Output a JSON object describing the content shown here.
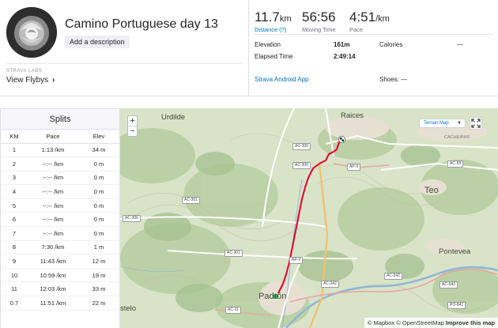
{
  "activity": {
    "title": "Camino Portuguese day 13",
    "add_description": "Add a description",
    "labs_caption": "STRAVA LABS",
    "flybys": "View Flybys"
  },
  "metrics": {
    "distance_value": "11.7",
    "distance_unit": "km",
    "distance_label": "Distance (?)",
    "moving_time_value": "56:56",
    "moving_time_label": "Moving Time",
    "pace_value": "4:51",
    "pace_unit": "/km",
    "pace_label": "Pace"
  },
  "stats": {
    "elevation_label": "Elevation",
    "elevation_value": "161m",
    "calories_label": "Calories",
    "calories_value": "—",
    "elapsed_label": "Elapsed Time",
    "elapsed_value": "2:49:14",
    "app_link": "Strava Android App",
    "shoes": "Shoes: —"
  },
  "splits": {
    "title": "Splits",
    "headers": [
      "KM",
      "Pace",
      "Elev"
    ],
    "rows": [
      {
        "km": "1",
        "pace": "1:13",
        "unit": "/km",
        "elev": "34 m"
      },
      {
        "km": "2",
        "pace": "--:--",
        "unit": "/km",
        "elev": "0 m"
      },
      {
        "km": "3",
        "pace": "--:--",
        "unit": "/km",
        "elev": "0 m"
      },
      {
        "km": "4",
        "pace": "--:--",
        "unit": "/km",
        "elev": "0 m"
      },
      {
        "km": "5",
        "pace": "--:--",
        "unit": "/km",
        "elev": "0 m"
      },
      {
        "km": "6",
        "pace": "--:--",
        "unit": "/km",
        "elev": "0 m"
      },
      {
        "km": "7",
        "pace": "--:--",
        "unit": "/km",
        "elev": "0 m"
      },
      {
        "km": "8",
        "pace": "7:30",
        "unit": "/km",
        "elev": "1 m"
      },
      {
        "km": "9",
        "pace": "11:43",
        "unit": "/km",
        "elev": "12 m"
      },
      {
        "km": "10",
        "pace": "10:59",
        "unit": "/km",
        "elev": "19 m"
      },
      {
        "km": "11",
        "pace": "12:03",
        "unit": "/km",
        "elev": "33 m"
      },
      {
        "km": "0.7",
        "pace": "11:51",
        "unit": "/km",
        "elev": "22 m"
      }
    ]
  },
  "map": {
    "places": [
      "Urdilde",
      "Raices",
      "Teo",
      "Pontevea",
      "Padrón",
      "stelo",
      "CACHEIRAS"
    ],
    "roads": [
      "AC-300",
      "AC-300",
      "AC-301",
      "AC-306",
      "AC-301",
      "AP-9",
      "AP-9",
      "AC-242",
      "AC-242",
      "AC-11",
      "AC-59",
      "AC-543",
      "PO-841"
    ],
    "zoom_in": "+",
    "zoom_out": "−",
    "layer_selector": "Terrain Map",
    "attribution_mapbox": "© Mapbox",
    "attribution_osm": "© OpenStreetMap",
    "attribution_improve": "Improve this map",
    "route_color": "#e4002b",
    "start_color": "#2db34a"
  }
}
